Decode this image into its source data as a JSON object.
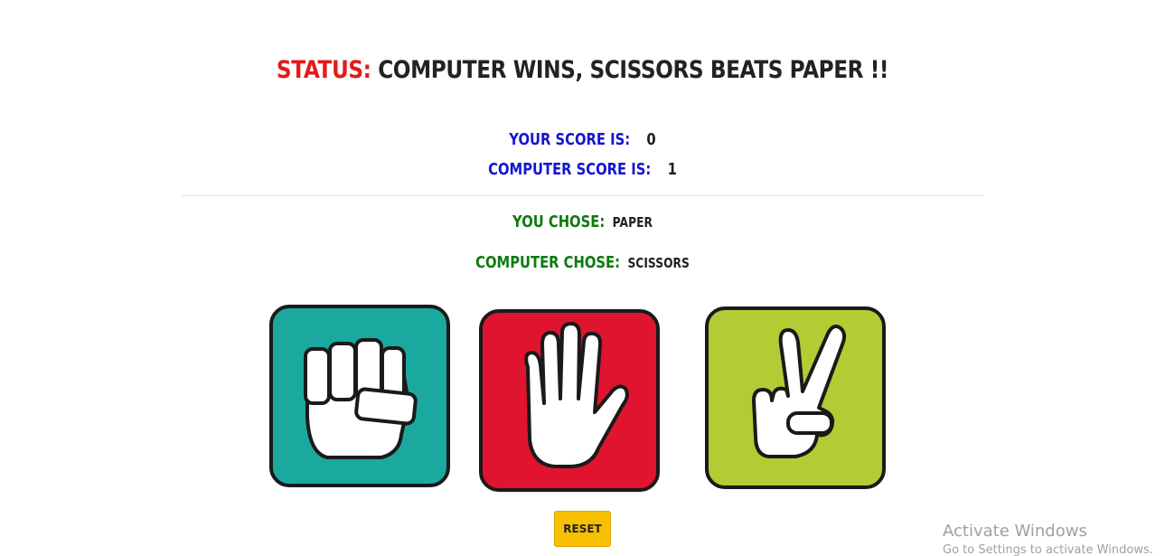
{
  "status": {
    "label": "Status:",
    "message": "Computer Wins, Scissors beats Paper !!",
    "label_color": "#e31b1b"
  },
  "scores": {
    "your_label": "Your Score is:",
    "your_value": "0",
    "computer_label": "Computer Score is:",
    "computer_value": "1"
  },
  "choices": {
    "you_label": "You Chose:",
    "you_value": "Paper",
    "computer_label": "Computer Chose:",
    "computer_value": "Scissors"
  },
  "options": [
    {
      "name": "rock",
      "icon": "fist-icon",
      "color": "#1ba89f"
    },
    {
      "name": "paper",
      "icon": "open-hand-icon",
      "color": "#e0142e"
    },
    {
      "name": "scissors",
      "icon": "peace-sign-icon",
      "color": "#b2cc34"
    }
  ],
  "reset_label": "Reset",
  "watermark": {
    "title": "Activate Windows",
    "subtitle": "Go to Settings to activate Windows."
  }
}
